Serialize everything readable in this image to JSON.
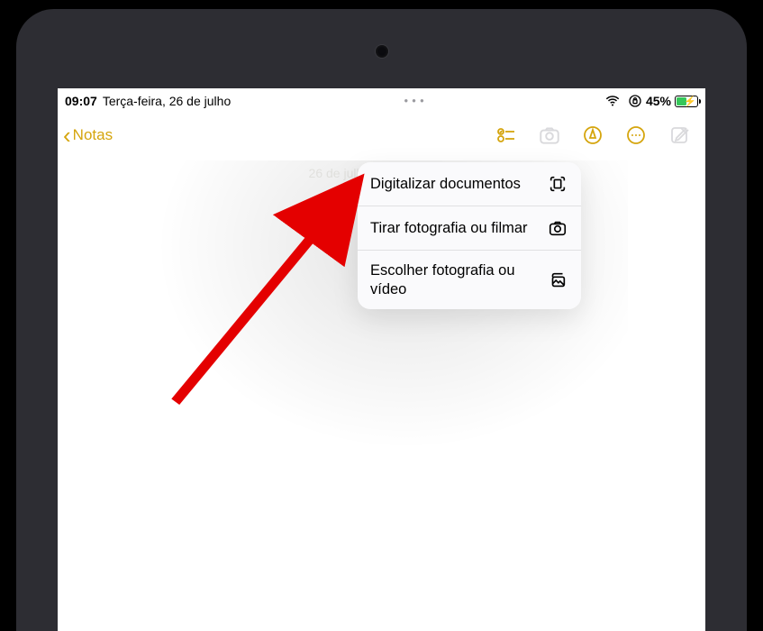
{
  "statusbar": {
    "time": "09:07",
    "date": "Terça-feira, 26 de julho",
    "battery_pct": "45%",
    "rotation_locked": true
  },
  "navbar": {
    "back_label": "Notas"
  },
  "note": {
    "date_placeholder": "26 de julho de 2022 09:07"
  },
  "menu": {
    "scan_docs": "Digitalizar documentos",
    "take_photo": "Tirar fotografia ou filmar",
    "choose_media": "Escolher fotografia ou vídeo"
  },
  "accent_color": "#d5a50d",
  "annotation_color": "#e40000"
}
